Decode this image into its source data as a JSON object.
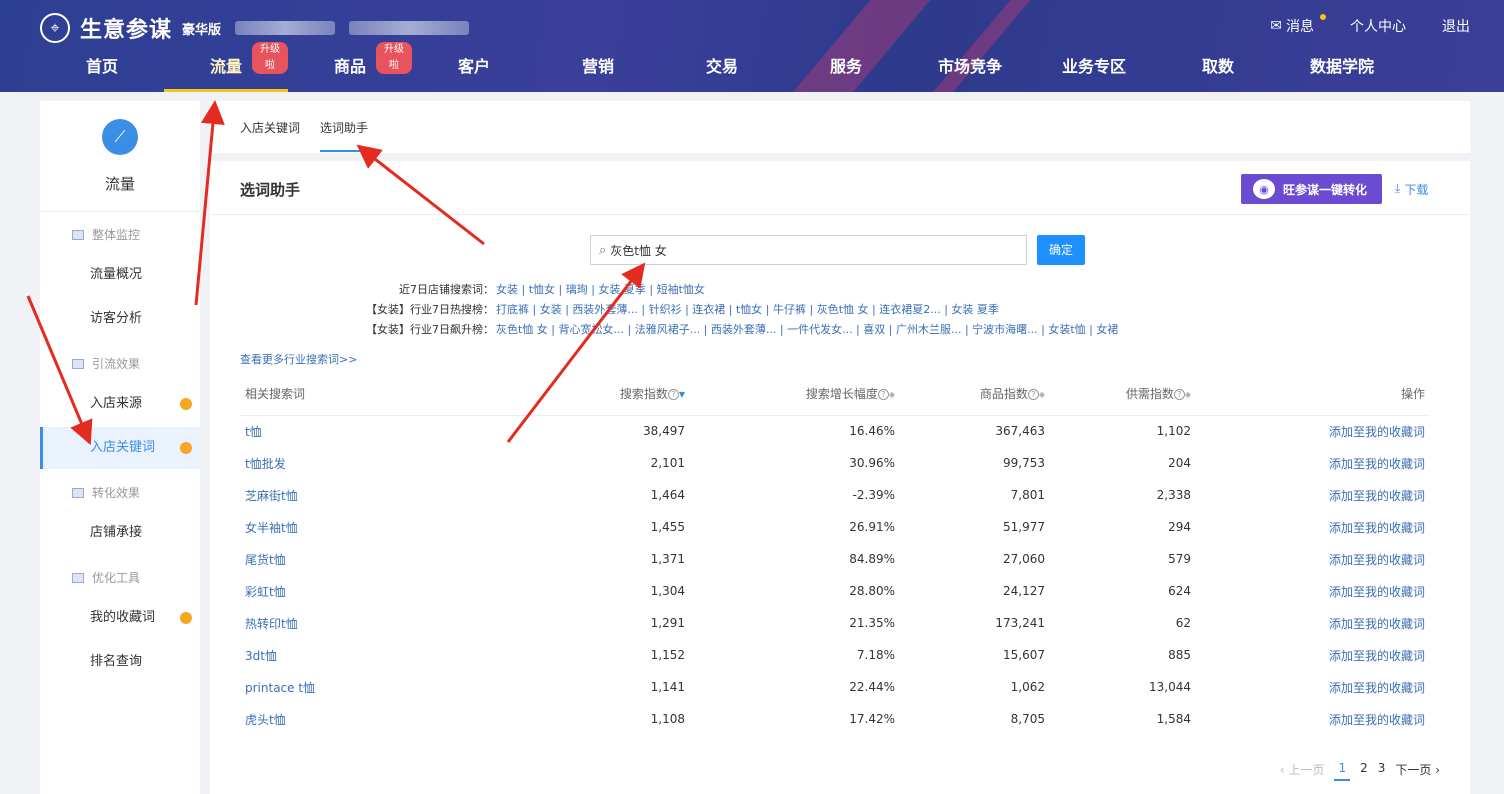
{
  "header": {
    "logo_text": "生意参谋",
    "edition": "豪华版",
    "top_links": [
      "消息",
      "个人中心",
      "退出"
    ],
    "nav": [
      {
        "label": "首页",
        "badge": ""
      },
      {
        "label": "流量",
        "badge": "升级啦"
      },
      {
        "label": "商品",
        "badge": "升级啦"
      },
      {
        "label": "客户",
        "badge": ""
      },
      {
        "label": "营销",
        "badge": ""
      },
      {
        "label": "交易",
        "badge": ""
      },
      {
        "label": "服务",
        "badge": ""
      },
      {
        "label": "市场竞争",
        "badge": ""
      },
      {
        "label": "业务专区",
        "badge": ""
      },
      {
        "label": "取数",
        "badge": ""
      },
      {
        "label": "数据学院",
        "badge": ""
      }
    ]
  },
  "sidebar": {
    "title": "流量",
    "groups": [
      "整体监控",
      "引流效果",
      "转化效果",
      "优化工具"
    ],
    "items": [
      "流量概况",
      "访客分析",
      "入店来源",
      "入店关键词",
      "店铺承接",
      "我的收藏词",
      "排名查询"
    ]
  },
  "tabs": [
    "入店关键词",
    "选词助手"
  ],
  "panel": {
    "title": "选词助手",
    "wang_button": "旺参谋一键转化",
    "download": "下载",
    "search_value": "灰色t恤 女",
    "confirm": "确定",
    "more_link": "查看更多行业搜索词>>"
  },
  "keyword_rows": [
    {
      "label": "近7日店铺搜索词：",
      "items": "女装 | t恤女 | 璃珣 | 女装 夏季 | 短袖t恤女"
    },
    {
      "label": "【女装】行业7日热搜榜：",
      "items": "打底裤 | 女装 | 西装外套薄... | 针织衫 | 连衣裙 | t恤女 | 牛仔裤 | 灰色t恤 女 | 连衣裙夏2... | 女装 夏季"
    },
    {
      "label": "【女装】行业7日飙升榜：",
      "items": "灰色t恤 女 | 背心宽松女... | 法雅风裙子... | 西装外套薄... | 一件代发女... | 喜双 | 广州木兰服... | 宁波市海曙... | 女装t恤 | 女裙"
    }
  ],
  "table": {
    "headers": [
      "相关搜索词",
      "搜索指数",
      "搜索增长幅度",
      "商品指数",
      "供需指数",
      "操作"
    ],
    "action_label": "添加至我的收藏词",
    "rows": [
      {
        "kw": "t恤",
        "search": "38,497",
        "growth": "16.46%",
        "goods": "367,463",
        "supply": "1,102"
      },
      {
        "kw": "t恤批发",
        "search": "2,101",
        "growth": "30.96%",
        "goods": "99,753",
        "supply": "204"
      },
      {
        "kw": "芝麻街t恤",
        "search": "1,464",
        "growth": "-2.39%",
        "goods": "7,801",
        "supply": "2,338"
      },
      {
        "kw": "女半袖t恤",
        "search": "1,455",
        "growth": "26.91%",
        "goods": "51,977",
        "supply": "294"
      },
      {
        "kw": "尾货t恤",
        "search": "1,371",
        "growth": "84.89%",
        "goods": "27,060",
        "supply": "579"
      },
      {
        "kw": "彩虹t恤",
        "search": "1,304",
        "growth": "28.80%",
        "goods": "24,127",
        "supply": "624"
      },
      {
        "kw": "热转印t恤",
        "search": "1,291",
        "growth": "21.35%",
        "goods": "173,241",
        "supply": "62"
      },
      {
        "kw": "3dt恤",
        "search": "1,152",
        "growth": "7.18%",
        "goods": "15,607",
        "supply": "885"
      },
      {
        "kw": "printace t恤",
        "search": "1,141",
        "growth": "22.44%",
        "goods": "1,062",
        "supply": "13,044"
      },
      {
        "kw": "虎头t恤",
        "search": "1,108",
        "growth": "17.42%",
        "goods": "8,705",
        "supply": "1,584"
      }
    ]
  },
  "pager": {
    "prev": "上一页",
    "pages": [
      "1",
      "2",
      "3"
    ],
    "next": "下一页"
  }
}
